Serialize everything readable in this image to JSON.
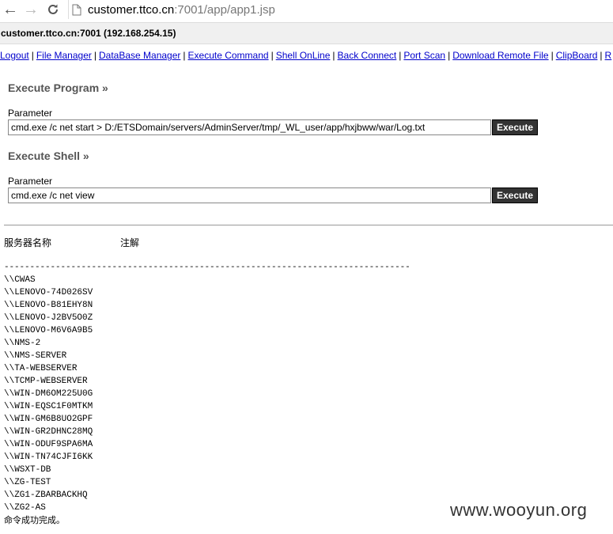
{
  "browser": {
    "url_host": "customer.ttco.cn",
    "url_path": ":7001/app/app1.jsp"
  },
  "host_info": "customer.ttco.cn:7001 (192.168.254.15)",
  "menu": [
    "Logout",
    "File Manager",
    "DataBase Manager",
    "Execute Command",
    "Shell OnLine",
    "Back Connect",
    "Port Scan",
    "Download Remote File",
    "ClipBoard",
    "R"
  ],
  "execute_program": {
    "title": "Execute Program »",
    "param_label": "Parameter",
    "value": "cmd.exe /c net start > D:/ETSDomain/servers/AdminServer/tmp/_WL_user/app/hxjbww/war/Log.txt",
    "button": "Execute"
  },
  "execute_shell": {
    "title": "Execute Shell »",
    "param_label": "Parameter",
    "value": "cmd.exe /c net view",
    "button": "Execute"
  },
  "output": {
    "col_server": "服务器名称",
    "col_note": "注解",
    "separator": "-------------------------------------------------------------------------------",
    "hosts": [
      "\\\\CWAS",
      "\\\\LENOVO-74D026SV",
      "\\\\LENOVO-B81EHY8N",
      "\\\\LENOVO-J2BV5O0Z",
      "\\\\LENOVO-M6V6A9B5",
      "\\\\NMS-2",
      "\\\\NMS-SERVER",
      "\\\\TA-WEBSERVER",
      "\\\\TCMP-WEBSERVER",
      "\\\\WIN-DM6OM225U0G",
      "\\\\WIN-EQSC1F0MTKM",
      "\\\\WIN-GM6B8UO2GPF",
      "\\\\WIN-GR2DHNC28MQ",
      "\\\\WIN-ODUF9SPA6MA",
      "\\\\WIN-TN74CJFI6KK",
      "\\\\WSXT-DB",
      "\\\\ZG-TEST",
      "\\\\ZG1-ZBARBACKHQ",
      "\\\\ZG2-AS"
    ],
    "footer": "命令成功完成。"
  },
  "watermark": "www.wooyun.org"
}
